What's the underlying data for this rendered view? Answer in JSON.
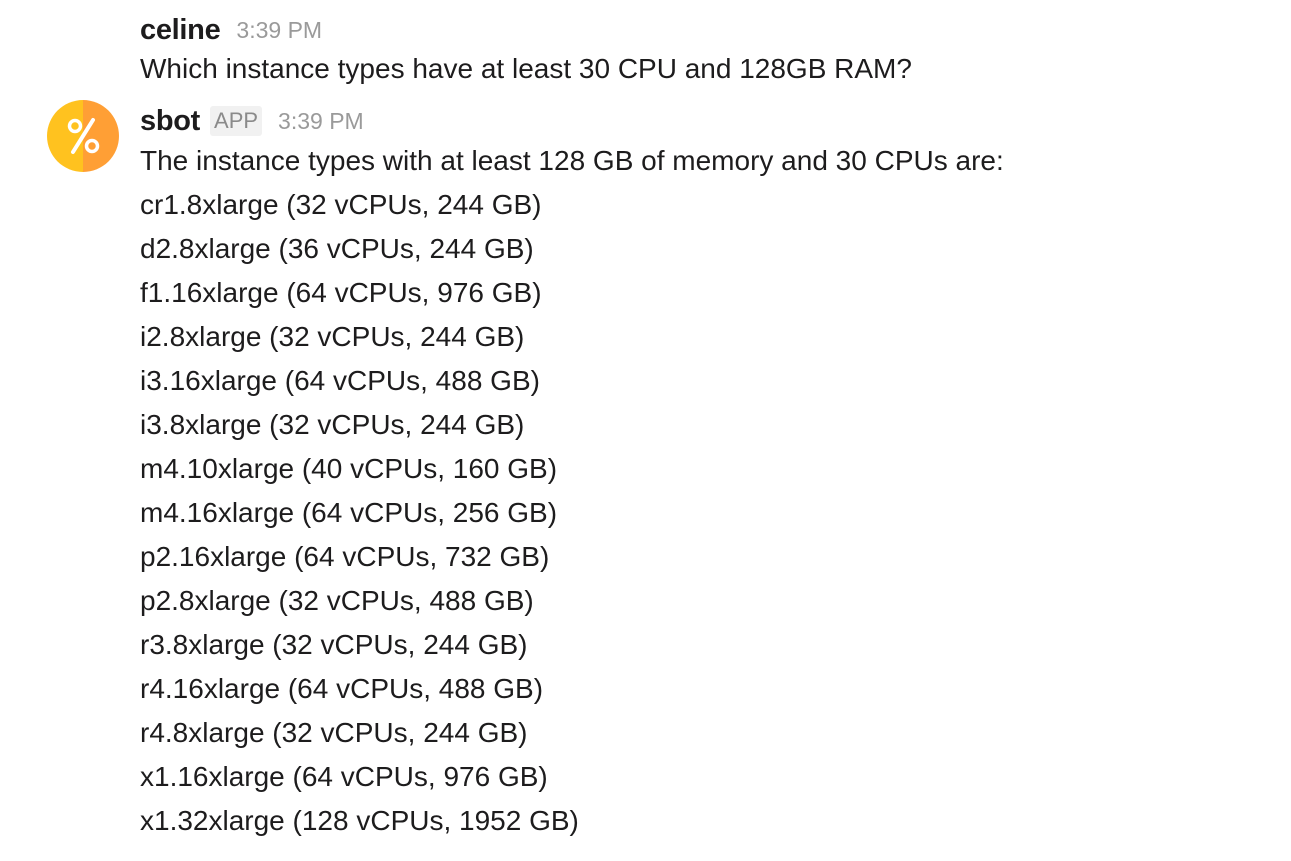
{
  "messages": {
    "celine": {
      "sender": "celine",
      "time": "3:39 PM",
      "text": "Which instance types have at least 30 CPU and 128GB RAM?"
    },
    "sbot": {
      "sender": "sbot",
      "badge": "APP",
      "time": "3:39 PM",
      "avatar_icon": "percent-icon",
      "avatar_colors": [
        "#ffc21f",
        "#ff9f35"
      ],
      "intro": "The instance types with at least 128 GB of memory and 30 CPUs are:",
      "lines": [
        "cr1.8xlarge (32 vCPUs, 244 GB)",
        "d2.8xlarge (36 vCPUs, 244 GB)",
        "f1.16xlarge (64 vCPUs, 976 GB)",
        "i2.8xlarge (32 vCPUs, 244 GB)",
        "i3.16xlarge (64 vCPUs, 488 GB)",
        "i3.8xlarge (32 vCPUs, 244 GB)",
        "m4.10xlarge (40 vCPUs, 160 GB)",
        "m4.16xlarge (64 vCPUs, 256 GB)",
        "p2.16xlarge (64 vCPUs, 732 GB)",
        "p2.8xlarge (32 vCPUs, 488 GB)",
        "r3.8xlarge (32 vCPUs, 244 GB)",
        "r4.16xlarge (64 vCPUs, 488 GB)",
        "r4.8xlarge (32 vCPUs, 244 GB)",
        "x1.16xlarge (64 vCPUs, 976 GB)",
        "x1.32xlarge (128 vCPUs, 1952 GB)"
      ]
    }
  }
}
